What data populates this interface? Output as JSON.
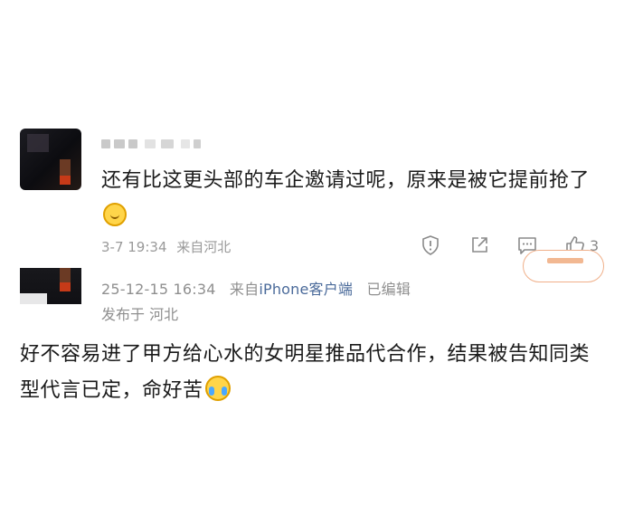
{
  "comment1": {
    "text": "还有比这更头部的车企邀请过呢，原来是被它提前抢了",
    "time": "3-7 19:34",
    "location": "来自河北",
    "likes": "3",
    "emoji_icon": "face-with-hand-over-mouth-icon"
  },
  "comment2": {
    "time": "25-12-15 16:34",
    "source_prefix": "来自",
    "source_device": "iPhone客户端",
    "edited": "已编辑",
    "location": "发布于 河北",
    "text": "好不容易进了甲方给心水的女明星推品代合作，结果被告知同类型代言已定，命好苦",
    "emoji_icon": "crying-face-icon"
  },
  "colors": {
    "accent": "#f0b08a",
    "link": "#4a6a9a",
    "meta": "#9a9a9a"
  }
}
